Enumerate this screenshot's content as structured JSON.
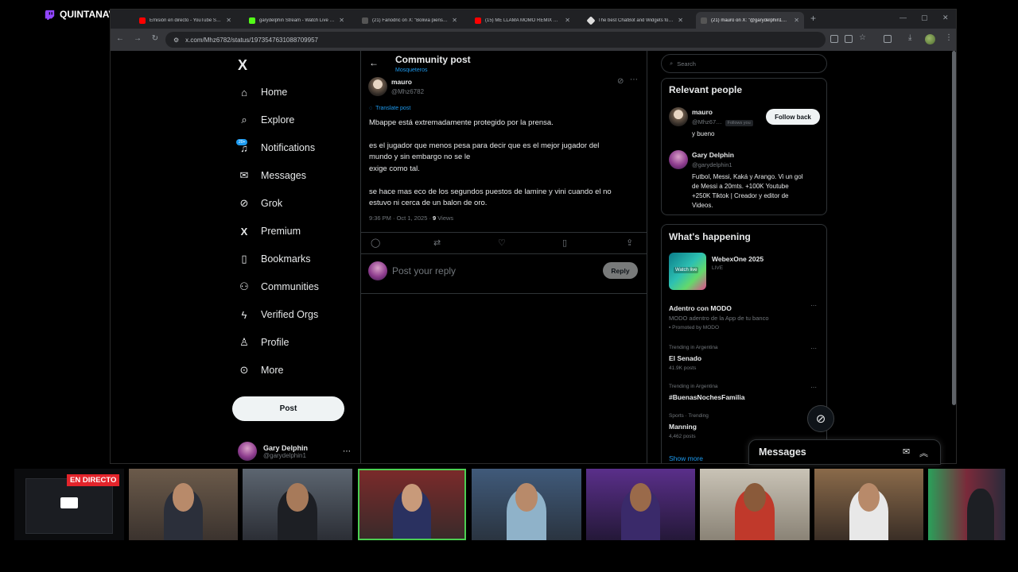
{
  "stream": {
    "brand": "QUINTANAVERSO",
    "live_badge": "EN DIRECTO"
  },
  "browser": {
    "tabs": [
      {
        "title": "Emisión en directo - YouTube Stu…",
        "color": "#ff0000"
      },
      {
        "title": "garydelphin Stream - Watch Live o…",
        "color": "#53fc18"
      },
      {
        "title": "(21) Fanodric on X: \"Bolivia piens…",
        "color": "#ffffff"
      },
      {
        "title": "(15) ME LLAMA MOMO REMIX Fe…",
        "color": "#ff0000"
      },
      {
        "title": "The best ChatBot and Widgets fo…",
        "color": "#ffffff"
      },
      {
        "title": "(21) mauro on X: \"@garydelphin1…",
        "color": "#ffffff"
      }
    ],
    "url": "x.com/Mhz6782/status/1973547631088709957"
  },
  "nav": {
    "logo": "X",
    "items": [
      {
        "label": "Home",
        "icon": "home-icon",
        "glyph": "⌂"
      },
      {
        "label": "Explore",
        "icon": "search-icon",
        "glyph": "⌕"
      },
      {
        "label": "Notifications",
        "icon": "bell-icon",
        "glyph": "🔔"
      },
      {
        "label": "Messages",
        "icon": "mail-icon",
        "glyph": "✉"
      },
      {
        "label": "Grok",
        "icon": "grok-icon",
        "glyph": "⊘"
      },
      {
        "label": "Premium",
        "icon": "x-premium-icon",
        "glyph": "𝕏"
      },
      {
        "label": "Bookmarks",
        "icon": "bookmark-icon",
        "glyph": "🔖"
      },
      {
        "label": "Communities",
        "icon": "people-icon",
        "glyph": "👥"
      },
      {
        "label": "Verified Orgs",
        "icon": "lightning-icon",
        "glyph": "ϟ"
      },
      {
        "label": "Profile",
        "icon": "person-icon",
        "glyph": "👤"
      },
      {
        "label": "More",
        "icon": "more-circle-icon",
        "glyph": "⋯"
      }
    ],
    "notif_badge": "20+",
    "post_label": "Post",
    "account_name": "Gary Delphin",
    "account_handle": "@garydelphin1"
  },
  "post": {
    "header_title": "Community post",
    "header_sub": "Mosqueteros",
    "author_name": "mauro",
    "author_handle": "@Mhz6782",
    "translate": "Translate post",
    "body_1": "Mbappe está extremadamente protegido por la prensa.",
    "body_2a": "es el jugador que menos pesa para decir que es el mejor jugador del",
    "body_2b": "mundo y sin embargo no se le",
    "body_2c": "exige como tal.",
    "body_3a": "se hace mas eco de los segundos puestos de lamine y vini cuando el no",
    "body_3b": "estuvo ni cerca de un balon de oro.",
    "meta_time": "9:36 PM · Oct 1, 2025 · ",
    "meta_views": "9",
    "meta_views_label": " Views",
    "reply_placeholder": "Post your reply",
    "reply_button": "Reply"
  },
  "sidebar": {
    "search_placeholder": "Search",
    "relevant_title": "Relevant people",
    "people": [
      {
        "name": "mauro",
        "handle": "@Mhz67…",
        "follows_you": "Follows you",
        "bio": "y bueno",
        "action": "Follow back"
      },
      {
        "name": "Gary Delphin",
        "handle": "@garydelphin1",
        "bio_1": "Futbol, Messi, Kaká y Arango. Vi un gol",
        "bio_2": "de Messi a 20mts. +100K Youtube",
        "bio_3": "+250K Tiktok | Creador y editor de",
        "bio_4": "Videos."
      }
    ],
    "happening_title": "What's happening",
    "event": {
      "name": "WebexOne 2025",
      "status": "LIVE",
      "thumb_text": "Watch live"
    },
    "promo": {
      "title": "Adentro con MODO",
      "desc": "MODO adentro de la App de tu banco",
      "promoted": "Promoted by MODO"
    },
    "trends": [
      {
        "context": "Trending in Argentina",
        "name": "El Senado",
        "posts": "41.9K posts"
      },
      {
        "context": "Trending in Argentina",
        "name": "#BuenasNochesFamilia",
        "posts": ""
      },
      {
        "context": "Sports · Trending",
        "name": "Manning",
        "posts": "4,462 posts"
      }
    ],
    "show_more": "Show more"
  },
  "messages_drawer": {
    "title": "Messages"
  }
}
